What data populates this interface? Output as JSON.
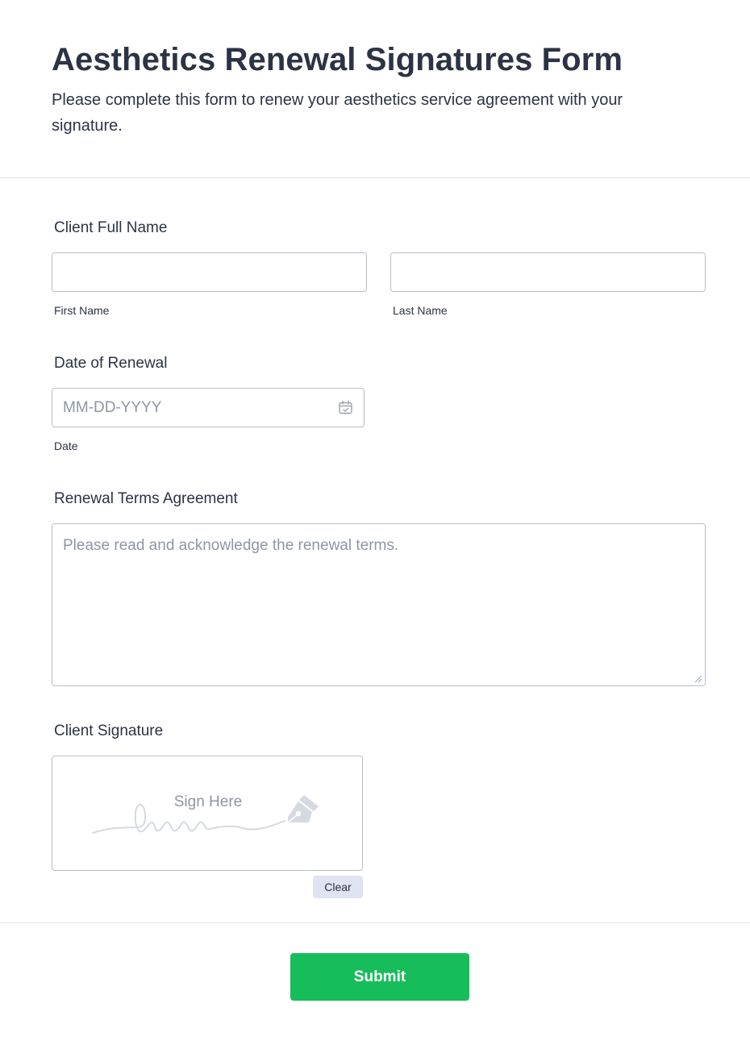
{
  "form": {
    "title": "Aesthetics Renewal Signatures Form",
    "subtitle": "Please complete this form to renew your aesthetics service agreement with your signature."
  },
  "fields": {
    "client_name": {
      "label": "Client Full Name",
      "first_sublabel": "First Name",
      "last_sublabel": "Last Name",
      "first_value": "",
      "last_value": ""
    },
    "renewal_date": {
      "label": "Date of Renewal",
      "placeholder": "MM-DD-YYYY",
      "sublabel": "Date",
      "icon": "calendar-icon"
    },
    "terms": {
      "label": "Renewal Terms Agreement",
      "placeholder": "Please read and acknowledge the renewal terms."
    },
    "signature": {
      "label": "Client Signature",
      "prompt": "Sign Here",
      "clear_label": "Clear",
      "icon": "pen-nib-icon"
    }
  },
  "actions": {
    "submit_label": "Submit"
  },
  "colors": {
    "submit": "#18bd5b",
    "text": "#2c3345",
    "placeholder": "#8f96a3",
    "clear_bg": "#dfe3f2"
  }
}
